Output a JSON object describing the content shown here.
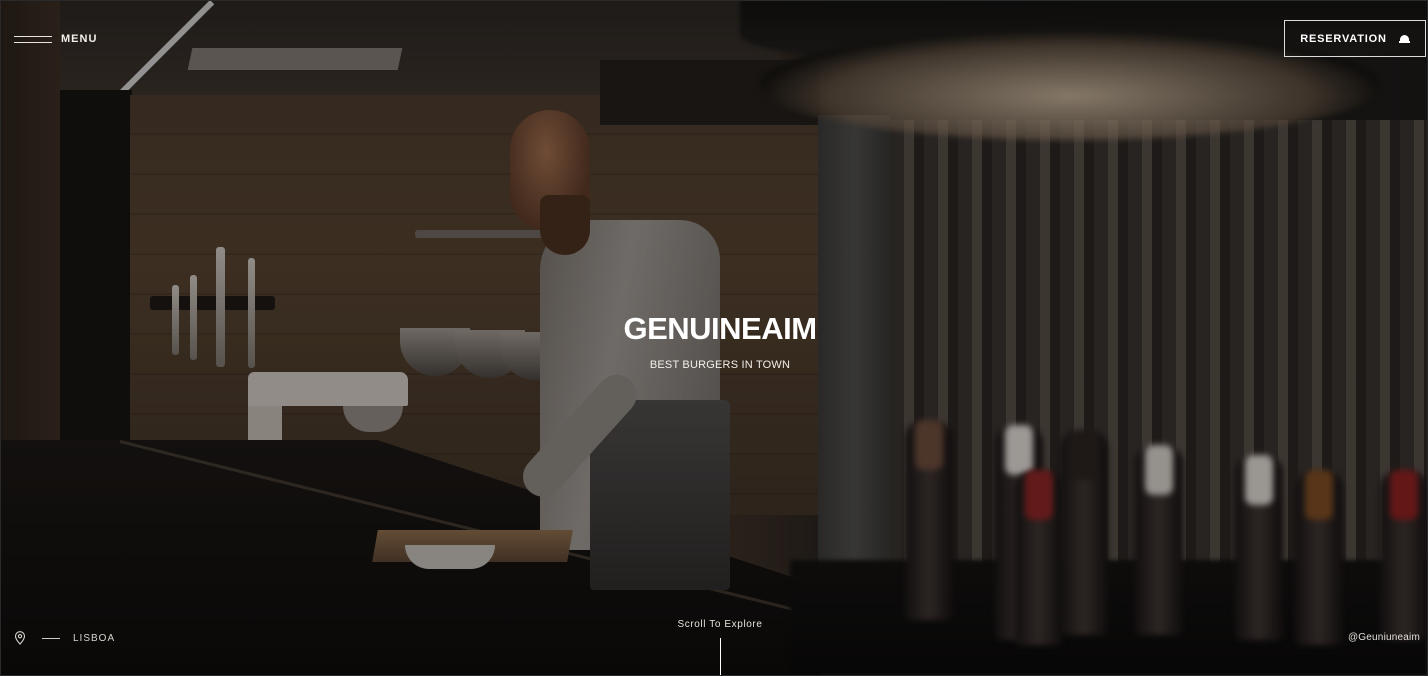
{
  "header": {
    "menu_label": "MENU",
    "reservation_label": "RESERVATION"
  },
  "hero": {
    "title": "GENUINEAIM",
    "subtitle": "BEST BURGERS IN TOWN"
  },
  "footer": {
    "location": "LISBOA",
    "scroll_hint": "Scroll To Explore",
    "social_handle": "@Geuniuneaim"
  },
  "icons": {
    "menu": "hamburger-icon",
    "reservation": "cloche-icon",
    "location": "map-pin-icon"
  },
  "colors": {
    "text": "#ffffff",
    "background": "#0d0b09"
  }
}
